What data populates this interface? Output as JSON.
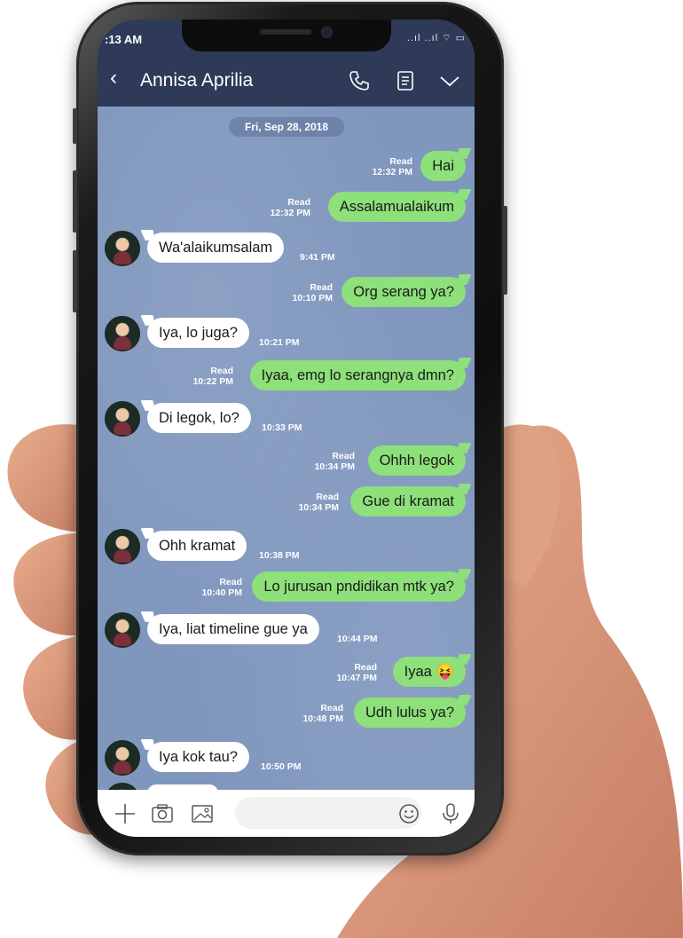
{
  "status": {
    "time": ":13 AM",
    "signal_text": "..ıl ..ıl ⌔ ▭"
  },
  "header": {
    "contact_name": "Annisa Aprilia"
  },
  "chat": {
    "date_label": "Fri, Sep 28, 2018",
    "messages": [
      {
        "from": "me",
        "text": "Hai",
        "read": "Read",
        "time": "12:32 PM"
      },
      {
        "from": "me",
        "text": "Assalamualaikum",
        "read": "Read",
        "time": "12:32 PM"
      },
      {
        "from": "them",
        "text": "Wa'alaikumsalam",
        "time": "9:41 PM"
      },
      {
        "from": "me",
        "text": "Org serang ya?",
        "read": "Read",
        "time": "10:10 PM"
      },
      {
        "from": "them",
        "text": "Iya, lo juga?",
        "time": "10:21 PM"
      },
      {
        "from": "me",
        "text": "Iyaa, emg lo serangnya dmn?",
        "read": "Read",
        "time": "10:22 PM"
      },
      {
        "from": "them",
        "text": "Di legok, lo?",
        "time": "10:33 PM"
      },
      {
        "from": "me",
        "text": "Ohhh legok",
        "read": "Read",
        "time": "10:34 PM"
      },
      {
        "from": "me",
        "text": "Gue di kramat",
        "read": "Read",
        "time": "10:34 PM"
      },
      {
        "from": "them",
        "text": "Ohh kramat",
        "time": "10:38 PM"
      },
      {
        "from": "me",
        "text": "Lo jurusan pndidikan mtk ya?",
        "read": "Read",
        "time": "10:40 PM"
      },
      {
        "from": "them",
        "text": "Iya, liat timeline gue ya",
        "time": "10:44 PM"
      },
      {
        "from": "me",
        "text": "Iyaa",
        "emoji": "😝",
        "read": "Read",
        "time": "10:47 PM"
      },
      {
        "from": "me",
        "text": "Udh lulus ya?",
        "read": "Read",
        "time": "10:48 PM"
      },
      {
        "from": "them",
        "text": "Iya kok tau?",
        "time": "10:50 PM"
      }
    ]
  },
  "colors": {
    "header_bg": "#2e3a57",
    "chat_bg": "#7f96bd",
    "my_bubble": "#8de07a",
    "their_bubble": "#ffffff"
  },
  "icons": {
    "header": [
      "back-chevron-icon",
      "phone-icon",
      "notes-icon",
      "chevron-down-icon"
    ],
    "input": [
      "plus-icon",
      "camera-icon",
      "image-icon",
      "emoji-icon",
      "microphone-icon"
    ]
  }
}
